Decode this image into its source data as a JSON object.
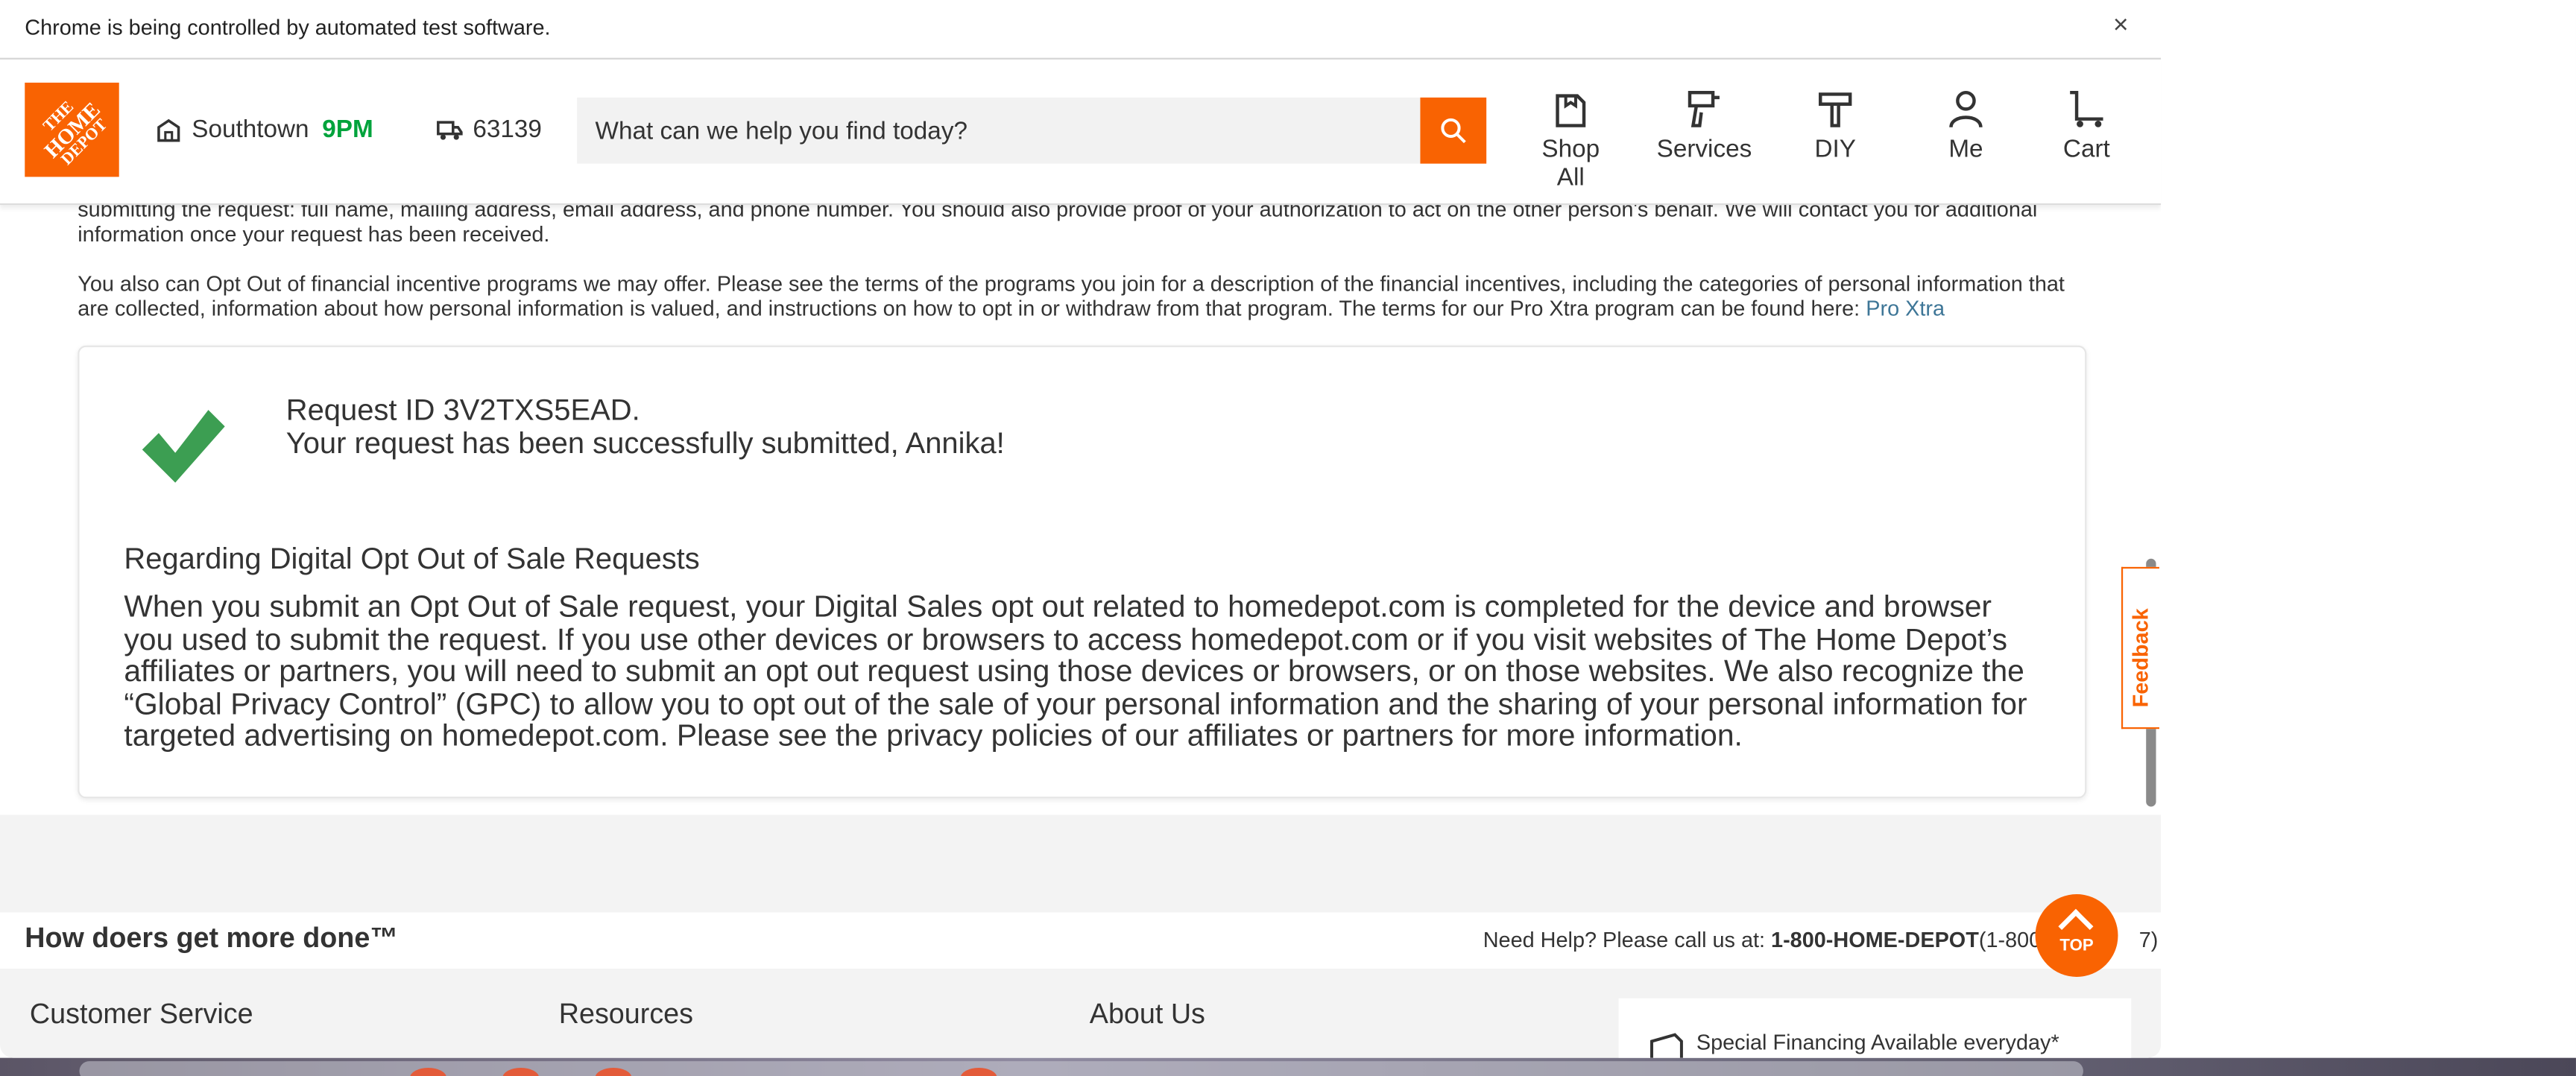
{
  "browser": {
    "infobar_text": "Chrome is being controlled by automated test software.",
    "close_glyph": "×"
  },
  "header": {
    "logo_lines": [
      "THE",
      "HOME",
      "DEPOT"
    ],
    "store_name": "Southtown",
    "store_hours": "9PM",
    "zip": "63139",
    "search_placeholder": "What can we help you find today?",
    "nav": [
      {
        "label": "Shop All",
        "icon": "shop-all-icon"
      },
      {
        "label": "Services",
        "icon": "services-icon"
      },
      {
        "label": "DIY",
        "icon": "diy-icon"
      },
      {
        "label": "Me",
        "icon": "user-icon"
      },
      {
        "label": "Cart",
        "icon": "cart-icon"
      }
    ]
  },
  "content": {
    "para1": "submitting the request: full name, mailing address, email address, and phone number. You should also provide proof of your authorization to act on the other person's behalf. We will contact you for additional information once your request has been received.",
    "para2": "You also can Opt Out of financial incentive programs we may offer. Please see the terms of the programs you join for a description of the financial incentives, including the categories of personal information that are collected, information about how personal information is valued, and instructions on how to opt in or withdraw from that program. The terms for our Pro Xtra program can be found here:",
    "para2_link": "Pro Xtra",
    "request_id": "Request ID 3V2TXS5EAD.",
    "request_message": "Your request has been successfully submitted, Annika!",
    "digital_heading": "Regarding Digital Opt Out of Sale Requests",
    "digital_body": "When you submit an Opt Out of Sale request, your Digital Sales opt out related to homedepot.com is completed for the device and browser you used to submit the request. If you use other devices or browsers to access homedepot.com or if you visit websites of The Home Depot’s affiliates or partners, you will need to submit an opt out request using those devices or browsers, or on those websites. We also recognize the “Global Privacy Control” (GPC) to allow you to opt out of the sale of your personal information and the sharing of your personal information for targeted advertising on homedepot.com. Please see the privacy policies of our affiliates or partners for more information."
  },
  "feedback_label": "Feedback",
  "footer": {
    "tagline": "How doers get more done™",
    "help_prefix": "Need Help? Please call us at: ",
    "help_phone": "1-800-HOME-DEPOT",
    "help_suffix": "(1-800-",
    "help_tail": "7)",
    "top_label": "TOP",
    "columns": [
      "Customer Service",
      "Resources",
      "About Us"
    ],
    "financing": "Special Financing Available everyday*"
  },
  "colors": {
    "brand_orange": "#f96302",
    "check_green": "#3c9e52",
    "hours_green": "#00a33c",
    "link_blue": "#3e7697"
  }
}
